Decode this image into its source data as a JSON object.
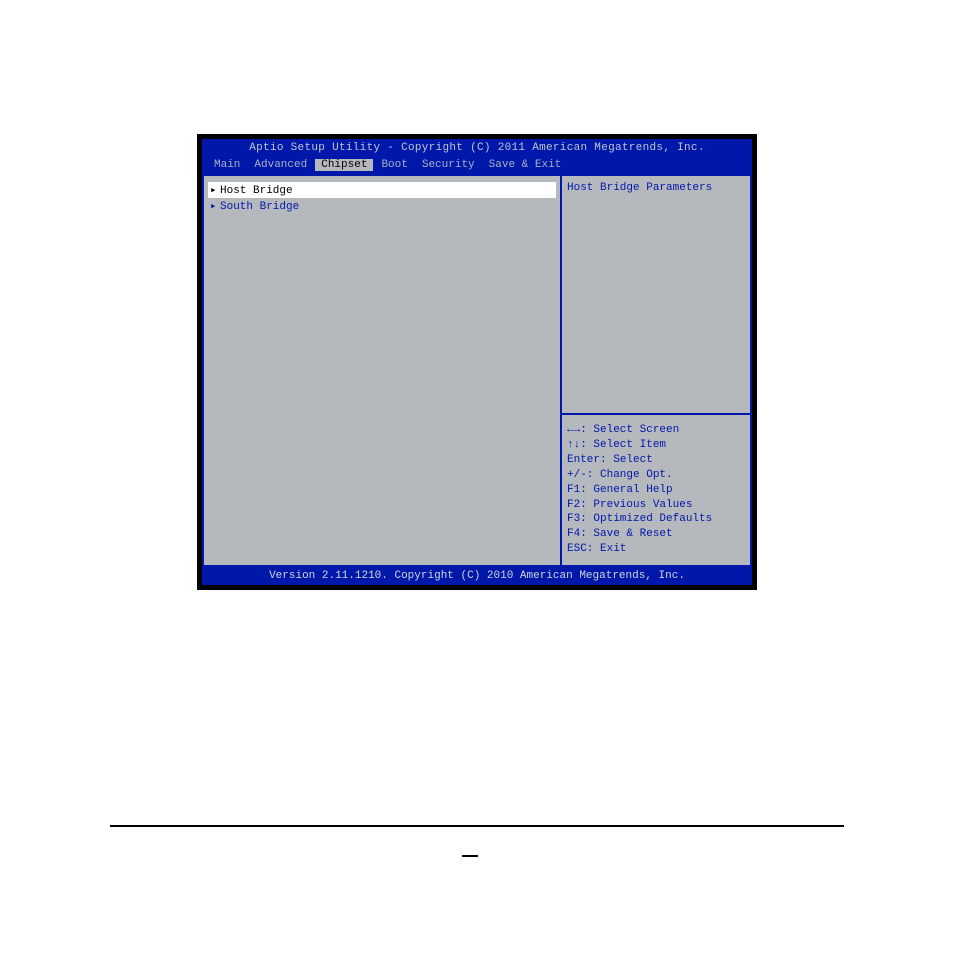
{
  "header": {
    "title": "Aptio Setup Utility - Copyright (C) 2011 American Megatrends, Inc."
  },
  "tabs": [
    {
      "label": "Main",
      "active": false
    },
    {
      "label": "Advanced",
      "active": false
    },
    {
      "label": "Chipset",
      "active": true
    },
    {
      "label": "Boot",
      "active": false
    },
    {
      "label": "Security",
      "active": false
    },
    {
      "label": "Save & Exit",
      "active": false
    }
  ],
  "menu": {
    "items": [
      {
        "label": "Host Bridge",
        "selected": true
      },
      {
        "label": "South Bridge",
        "selected": false
      }
    ]
  },
  "help_text": "Host Bridge Parameters",
  "keyhelp": [
    "←→: Select Screen",
    "↑↓: Select Item",
    "Enter: Select",
    "+/-: Change Opt.",
    "F1: General Help",
    "F2: Previous Values",
    "F3: Optimized Defaults",
    "F4: Save & Reset",
    "ESC: Exit"
  ],
  "footer": {
    "text": "Version 2.11.1210. Copyright (C) 2010 American Megatrends, Inc."
  }
}
